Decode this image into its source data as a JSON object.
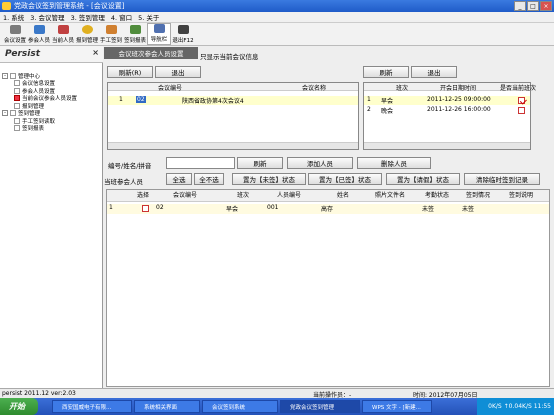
{
  "window": {
    "title": "党政会议签到管理系统 - [会议设置]"
  },
  "menu": [
    "1. 系统",
    "3. 会议管理",
    "3. 签到管理",
    "4. 窗口",
    "5. 关于"
  ],
  "toolbar": [
    {
      "label": "会议设置",
      "icon": "settings-icon",
      "color": "#7a7a7a"
    },
    {
      "label": "参会人员",
      "icon": "people-icon",
      "color": "#3a78c8"
    },
    {
      "label": "当前人员",
      "icon": "user-icon",
      "color": "#c04040"
    },
    {
      "label": "报到管理",
      "icon": "smile-icon",
      "color": "#e0b020"
    },
    {
      "label": "手工签到",
      "icon": "hand-icon",
      "color": "#d08030"
    },
    {
      "label": "签到报表",
      "icon": "report-icon",
      "color": "#508c3c"
    },
    {
      "label": "导航栏",
      "icon": "nav-icon",
      "color": "#5070b0"
    },
    {
      "label": "退出F12",
      "icon": "exit-icon",
      "color": "#404040"
    }
  ],
  "leftpane": {
    "title": "Persist",
    "close": "×"
  },
  "tree": [
    {
      "label": "管理中心",
      "level": 0,
      "expand": "-",
      "icon": "folder-icon"
    },
    {
      "label": "会议信息设置",
      "level": 1,
      "icon": "doc-icon"
    },
    {
      "label": "参会人员设置",
      "level": 1,
      "icon": "doc-icon"
    },
    {
      "label": "当前会议参会人员设置",
      "level": 1,
      "icon": "checked-icon"
    },
    {
      "label": "报到管理",
      "level": 1,
      "icon": "doc-icon"
    },
    {
      "label": "签到管理",
      "level": 0,
      "expand": "-",
      "icon": "folder-icon"
    },
    {
      "label": "手工签到读取",
      "level": 1,
      "icon": "doc-icon"
    },
    {
      "label": "签到报表",
      "level": 1,
      "icon": "doc-icon"
    }
  ],
  "header": {
    "tab": "会议班次参会人员设置",
    "note": "只显示当前会议信息"
  },
  "left_panel": {
    "refresh": "刷新(R)",
    "exit": "退出",
    "columns": [
      "会议编号",
      "会议名称"
    ],
    "rows": [
      {
        "num": "1",
        "id": "02",
        "name": "陕西省政协第4次会议4"
      }
    ]
  },
  "right_panel": {
    "refresh": "刷新",
    "exit": "退出",
    "columns": [
      "班次",
      "开会日期时间",
      "是否当前班次"
    ],
    "rows": [
      {
        "num": "1",
        "shift": "早会",
        "datetime": "2011-12-25 09:00:00",
        "current": true
      },
      {
        "num": "2",
        "shift": "晚会",
        "datetime": "2011-12-26 16:00:00",
        "current": false
      }
    ]
  },
  "controls": {
    "search_label": "编号/姓名/拼音",
    "search_value": "",
    "refresh": "刷新",
    "add": "添加人员",
    "delete": "删除人员",
    "attendees_label": "当班参会人员",
    "select_all": "全选",
    "select_none": "全不选",
    "set_unsigned": "置为【未签】状态",
    "set_signed": "置为【已签】状态",
    "set_leave": "置为【请假】状态",
    "clear_temp": "清除临时签到记录"
  },
  "grid": {
    "columns": [
      "选择",
      "会议编号",
      "班次",
      "人员编号",
      "姓名",
      "照片文件名",
      "考勤状态",
      "签到情况",
      "签到说明"
    ],
    "rows": [
      {
        "num": "1",
        "checked": false,
        "meeting": "02",
        "shift": "早会",
        "person": "001",
        "name": "高存",
        "photo": "",
        "attendance": "未签",
        "signin": "未签",
        "note": ""
      }
    ]
  },
  "statusbar": {
    "version": "persist 2011.12 ver:2.03",
    "operator": "当前操作员：-",
    "time": "时间: 2012年07月05日"
  },
  "taskbar": {
    "start": "开始",
    "items": [
      "西安国威电子有限...",
      "系统相关界面",
      "会议签到系统",
      "党政会议签到管理",
      "WPS 文字 - [新建..."
    ],
    "tray": "0K/S ↑0.04K/S  11:55"
  }
}
